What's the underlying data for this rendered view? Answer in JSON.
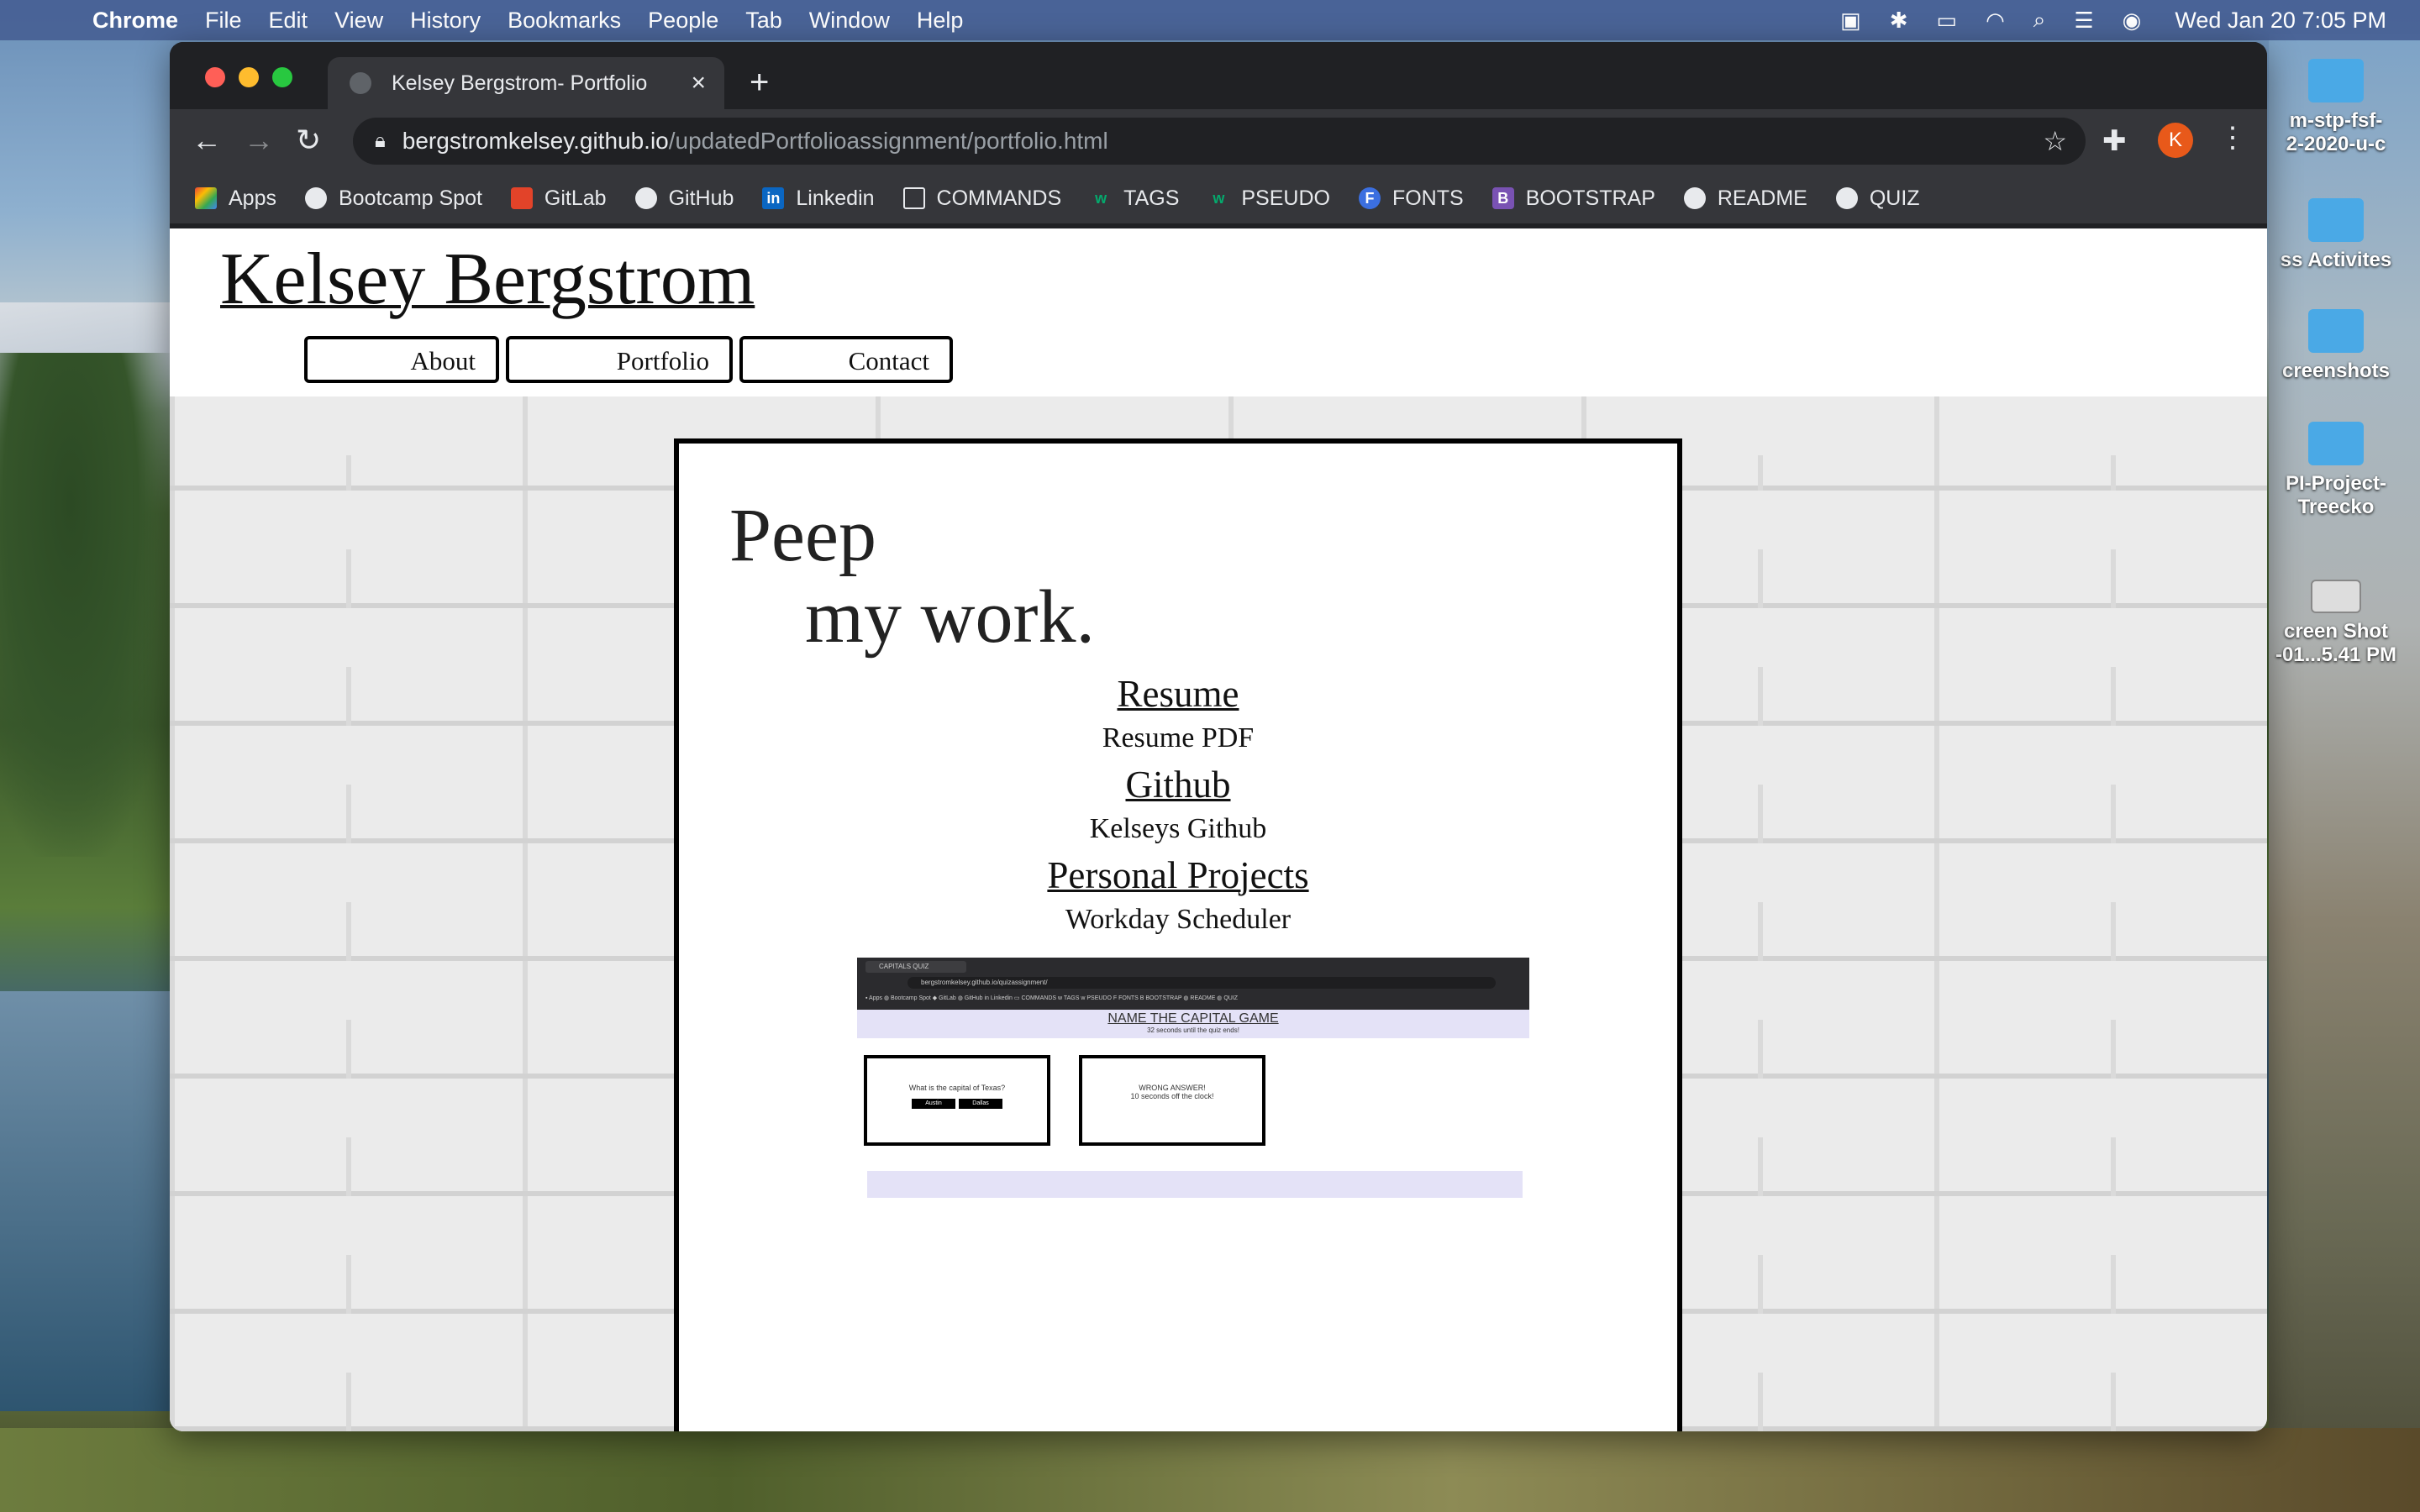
{
  "menubar": {
    "app": "Chrome",
    "items": [
      "File",
      "Edit",
      "View",
      "History",
      "Bookmarks",
      "People",
      "Tab",
      "Window",
      "Help"
    ],
    "clock": "Wed Jan 20  7:05 PM"
  },
  "browser": {
    "tab_title": "Kelsey Bergstrom- Portfolio",
    "url_host": "bergstromkelsey.github.io",
    "url_path": "/updatedPortfolioassignment/portfolio.html",
    "profile_initial": "K",
    "bookmarks": [
      "Apps",
      "Bootcamp Spot",
      "GitLab",
      "GitHub",
      "Linkedin",
      "COMMANDS",
      "TAGS",
      "PSEUDO",
      "FONTS",
      "BOOTSTRAP",
      "README",
      "QUIZ"
    ]
  },
  "site": {
    "title": "Kelsey Bergstrom",
    "nav": [
      "About",
      "Portfolio",
      "Contact"
    ],
    "headline_line1": "Peep",
    "headline_line2": "my work.",
    "sections": [
      {
        "heading": "Resume",
        "item": "Resume PDF"
      },
      {
        "heading": "Github",
        "item": "Kelseys Github"
      },
      {
        "heading": "Personal Projects",
        "item": "Workday Scheduler"
      }
    ],
    "preview": {
      "tab": "CAPITALS QUIZ",
      "url": "bergstromkelsey.github.io/quizassignment/",
      "title": "NAME THE CAPITAL GAME",
      "subtitle": "32 seconds until the quiz ends!",
      "question": "What is the capital of Texas?",
      "answer1": "Austin",
      "answer2": "Dallas",
      "feedback1": "WRONG ANSWER!",
      "feedback2": "10 seconds off the clock!"
    }
  },
  "desktop": {
    "icons": [
      "m-stp-fsf-\n2-2020-u-c",
      "ss Activites",
      "creenshots",
      "PI-Project-\nTreecko",
      "creen Shot\n-01...5.41 PM"
    ]
  }
}
